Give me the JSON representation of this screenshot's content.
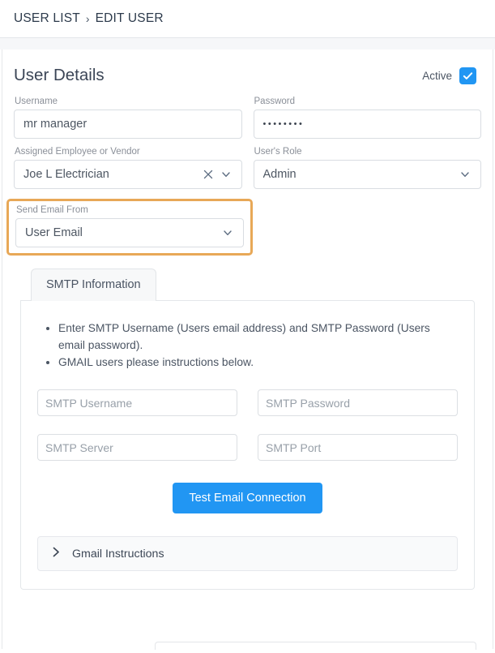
{
  "breadcrumb": {
    "root": "USER LIST",
    "separator": "›",
    "current": "EDIT USER"
  },
  "card": {
    "title": "User Details",
    "active_label": "Active",
    "active_checked": true,
    "accent_color": "#2196f3",
    "highlight_color": "#e8a857"
  },
  "form": {
    "username": {
      "label": "Username",
      "value": "mr manager",
      "placeholder": "Username"
    },
    "password": {
      "label": "Password",
      "value": "••••••••",
      "placeholder": "Password"
    },
    "assigned": {
      "label": "Assigned Employee or Vendor",
      "value": "Joe L Electrician",
      "clear_icon": "close-icon",
      "dropdown_icon": "chevron-down-icon"
    },
    "role": {
      "label": "User's Role",
      "value": "Admin",
      "dropdown_icon": "chevron-down-icon"
    },
    "send_email_from": {
      "label": "Send Email From",
      "value": "User Email",
      "dropdown_icon": "chevron-down-icon",
      "highlighted": true
    }
  },
  "smtp": {
    "tab_label": "SMTP Information",
    "instructions": [
      "Enter SMTP Username (Users email address) and SMTP Password (Users email password).",
      "GMAIL users please instructions below."
    ],
    "fields": {
      "username_placeholder": "SMTP Username",
      "password_placeholder": "SMTP Password",
      "server_placeholder": "SMTP Server",
      "port_placeholder": "SMTP Port"
    },
    "test_button_label": "Test Email Connection",
    "gmail_accordion": {
      "label": "Gmail Instructions",
      "expand_icon": "chevron-right-icon",
      "expanded": false
    }
  }
}
